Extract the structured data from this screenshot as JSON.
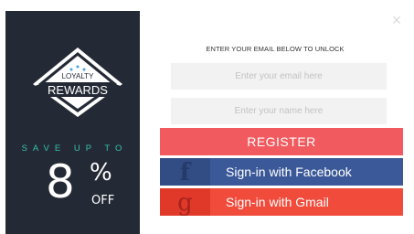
{
  "badge": {
    "line1": "LOYALTY",
    "line2": "REWARDS"
  },
  "promo": {
    "tagline": "SAVE UP TO",
    "amount": "8",
    "percent_sign": "%",
    "off": "OFF"
  },
  "form": {
    "headline": "ENTER YOUR EMAIL BELOW TO UNLOCK",
    "email_placeholder": "Enter your email here",
    "name_placeholder": "Enter your name here",
    "register_label": "REGISTER"
  },
  "social": {
    "facebook_icon": "f",
    "facebook_label": "Sign-in with Facebook",
    "gmail_icon": "g",
    "gmail_label": "Sign-in with Gmail"
  },
  "close_glyph": "×",
  "colors": {
    "left_panel": "#242a35",
    "accent_teal": "#35c2a8",
    "register": "#f15a5f",
    "facebook": "#3b5998",
    "gmail": "#f04b3b"
  }
}
